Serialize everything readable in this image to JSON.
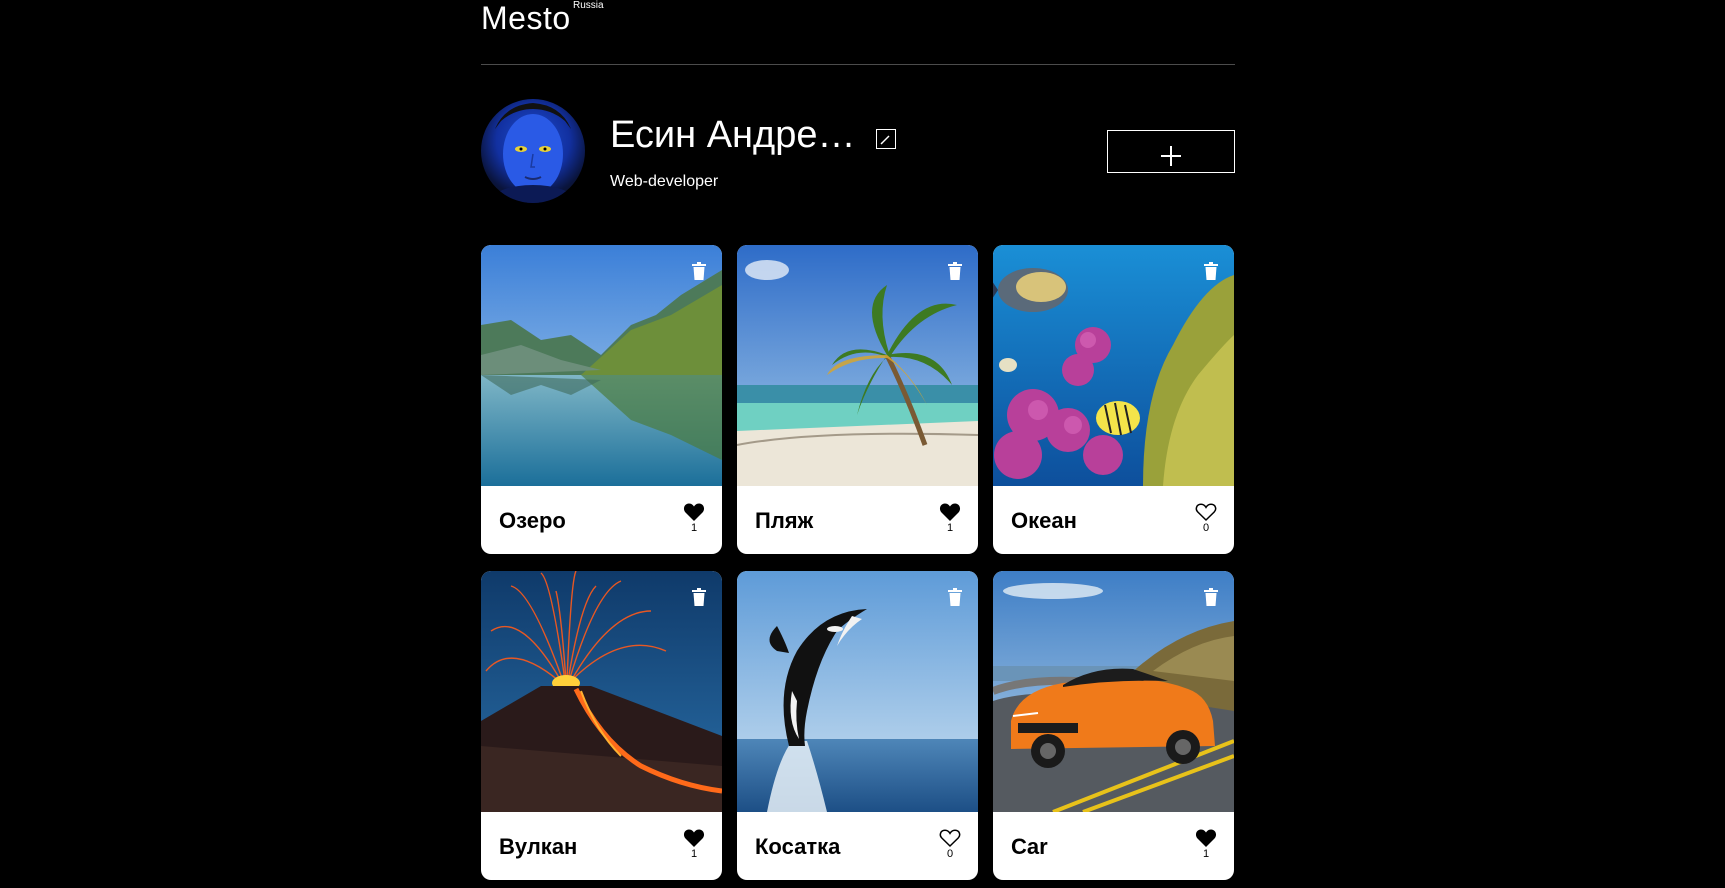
{
  "header": {
    "logo": "Mesto",
    "logo_sup": "Russia"
  },
  "profile": {
    "name": "Есин Андре…",
    "about": "Web-developer",
    "avatar_icon": "avatar-icon",
    "edit_icon": "pencil-icon",
    "add_icon": "plus-icon"
  },
  "cards": [
    {
      "title": "Озеро",
      "likes": "1",
      "liked": true,
      "image": "lake"
    },
    {
      "title": "Пляж",
      "likes": "1",
      "liked": true,
      "image": "beach"
    },
    {
      "title": "Океан",
      "likes": "0",
      "liked": false,
      "image": "ocean"
    },
    {
      "title": "Вулкан",
      "likes": "1",
      "liked": true,
      "image": "volcano"
    },
    {
      "title": "Косатка",
      "likes": "0",
      "liked": false,
      "image": "orca"
    },
    {
      "title": "Car",
      "likes": "1",
      "liked": true,
      "image": "car"
    }
  ],
  "colors": {
    "background": "#000000",
    "card": "#ffffff",
    "text": "#ffffff",
    "card_text": "#000000"
  }
}
